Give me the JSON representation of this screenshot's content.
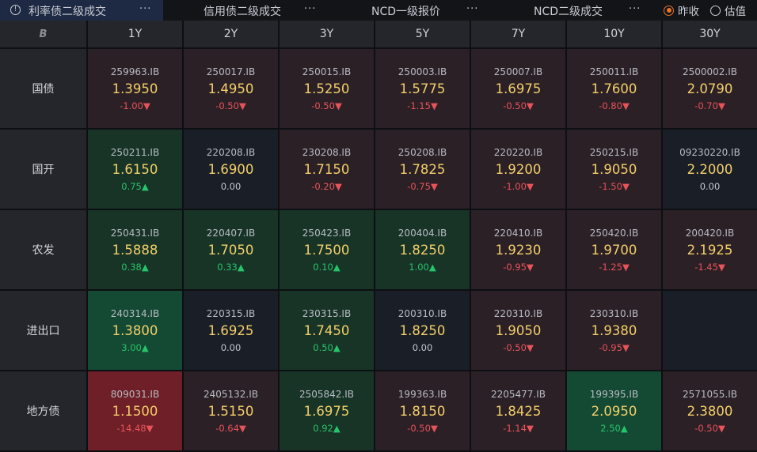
{
  "tabs": [
    {
      "label": "利率债二级成交",
      "more": "···"
    },
    {
      "label": "信用债二级成交",
      "more": "···"
    },
    {
      "label": "NCD一级报价",
      "more": "···"
    },
    {
      "label": "NCD二级成交",
      "more": "···"
    }
  ],
  "radio": [
    {
      "label": "昨收",
      "checked": true
    },
    {
      "label": "估值",
      "checked": false
    }
  ],
  "corner": "B",
  "tenors": [
    "1Y",
    "2Y",
    "3Y",
    "5Y",
    "7Y",
    "10Y",
    "30Y"
  ],
  "rows": [
    {
      "name": "国债",
      "cells": [
        {
          "code": "259963.IB",
          "yield": "1.3950",
          "chg": "-1.00▼",
          "dir": "down",
          "tone": "red"
        },
        {
          "code": "250017.IB",
          "yield": "1.4950",
          "chg": "-0.50▼",
          "dir": "down",
          "tone": "red"
        },
        {
          "code": "250015.IB",
          "yield": "1.5250",
          "chg": "-0.50▼",
          "dir": "down",
          "tone": "red"
        },
        {
          "code": "250003.IB",
          "yield": "1.5775",
          "chg": "-1.15▼",
          "dir": "down",
          "tone": "red"
        },
        {
          "code": "250007.IB",
          "yield": "1.6975",
          "chg": "-0.50▼",
          "dir": "down",
          "tone": "red"
        },
        {
          "code": "250011.IB",
          "yield": "1.7600",
          "chg": "-0.80▼",
          "dir": "down",
          "tone": "red"
        },
        {
          "code": "2500002.IB",
          "yield": "2.0790",
          "chg": "-0.70▼",
          "dir": "down",
          "tone": "red"
        }
      ]
    },
    {
      "name": "国开",
      "cells": [
        {
          "code": "250211.IB",
          "yield": "1.6150",
          "chg": "0.75▲",
          "dir": "up",
          "tone": "green"
        },
        {
          "code": "220208.IB",
          "yield": "1.6900",
          "chg": "0.00",
          "dir": "flat",
          "tone": "neutral"
        },
        {
          "code": "230208.IB",
          "yield": "1.7150",
          "chg": "-0.20▼",
          "dir": "down",
          "tone": "red"
        },
        {
          "code": "250208.IB",
          "yield": "1.7825",
          "chg": "-0.75▼",
          "dir": "down",
          "tone": "red"
        },
        {
          "code": "220220.IB",
          "yield": "1.9200",
          "chg": "-1.00▼",
          "dir": "down",
          "tone": "red"
        },
        {
          "code": "250215.IB",
          "yield": "1.9050",
          "chg": "-1.50▼",
          "dir": "down",
          "tone": "red"
        },
        {
          "code": "09230220.IB",
          "yield": "2.2000",
          "chg": "0.00",
          "dir": "flat",
          "tone": "neutral"
        }
      ]
    },
    {
      "name": "农发",
      "cells": [
        {
          "code": "250431.IB",
          "yield": "1.5888",
          "chg": "0.38▲",
          "dir": "up",
          "tone": "green"
        },
        {
          "code": "220407.IB",
          "yield": "1.7050",
          "chg": "0.33▲",
          "dir": "up",
          "tone": "green"
        },
        {
          "code": "250423.IB",
          "yield": "1.7500",
          "chg": "0.10▲",
          "dir": "up",
          "tone": "green"
        },
        {
          "code": "200404.IB",
          "yield": "1.8250",
          "chg": "1.00▲",
          "dir": "up",
          "tone": "green"
        },
        {
          "code": "220410.IB",
          "yield": "1.9230",
          "chg": "-0.95▼",
          "dir": "down",
          "tone": "red"
        },
        {
          "code": "250420.IB",
          "yield": "1.9700",
          "chg": "-1.25▼",
          "dir": "down",
          "tone": "red"
        },
        {
          "code": "200420.IB",
          "yield": "2.1925",
          "chg": "-1.45▼",
          "dir": "down",
          "tone": "red"
        }
      ]
    },
    {
      "name": "进出口",
      "cells": [
        {
          "code": "240314.IB",
          "yield": "1.3800",
          "chg": "3.00▲",
          "dir": "up",
          "tone": "deepgreen"
        },
        {
          "code": "220315.IB",
          "yield": "1.6925",
          "chg": "0.00",
          "dir": "flat",
          "tone": "neutral"
        },
        {
          "code": "230315.IB",
          "yield": "1.7450",
          "chg": "0.50▲",
          "dir": "up",
          "tone": "green"
        },
        {
          "code": "200310.IB",
          "yield": "1.8250",
          "chg": "0.00",
          "dir": "flat",
          "tone": "neutral"
        },
        {
          "code": "220310.IB",
          "yield": "1.9050",
          "chg": "-0.50▼",
          "dir": "down",
          "tone": "red"
        },
        {
          "code": "230310.IB",
          "yield": "1.9380",
          "chg": "-0.95▼",
          "dir": "down",
          "tone": "red"
        },
        null
      ]
    },
    {
      "name": "地方债",
      "cells": [
        {
          "code": "809031.IB",
          "yield": "1.1500",
          "chg": "-14.48▼",
          "dir": "down",
          "tone": "deepred"
        },
        {
          "code": "2405132.IB",
          "yield": "1.5150",
          "chg": "-0.64▼",
          "dir": "down",
          "tone": "red"
        },
        {
          "code": "2505842.IB",
          "yield": "1.6975",
          "chg": "0.92▲",
          "dir": "up",
          "tone": "green"
        },
        {
          "code": "199363.IB",
          "yield": "1.8150",
          "chg": "-0.50▼",
          "dir": "down",
          "tone": "red"
        },
        {
          "code": "2205477.IB",
          "yield": "1.8425",
          "chg": "-1.14▼",
          "dir": "down",
          "tone": "red"
        },
        {
          "code": "199395.IB",
          "yield": "2.0950",
          "chg": "2.50▲",
          "dir": "up",
          "tone": "deepgreen"
        },
        {
          "code": "2571055.IB",
          "yield": "2.3800",
          "chg": "-0.50▼",
          "dir": "down",
          "tone": "red"
        }
      ]
    }
  ],
  "colors": {
    "accent_radio": "#e8742a",
    "yield_text": "#f3cf6a",
    "up": "#27c46a",
    "down": "#e8535a"
  }
}
